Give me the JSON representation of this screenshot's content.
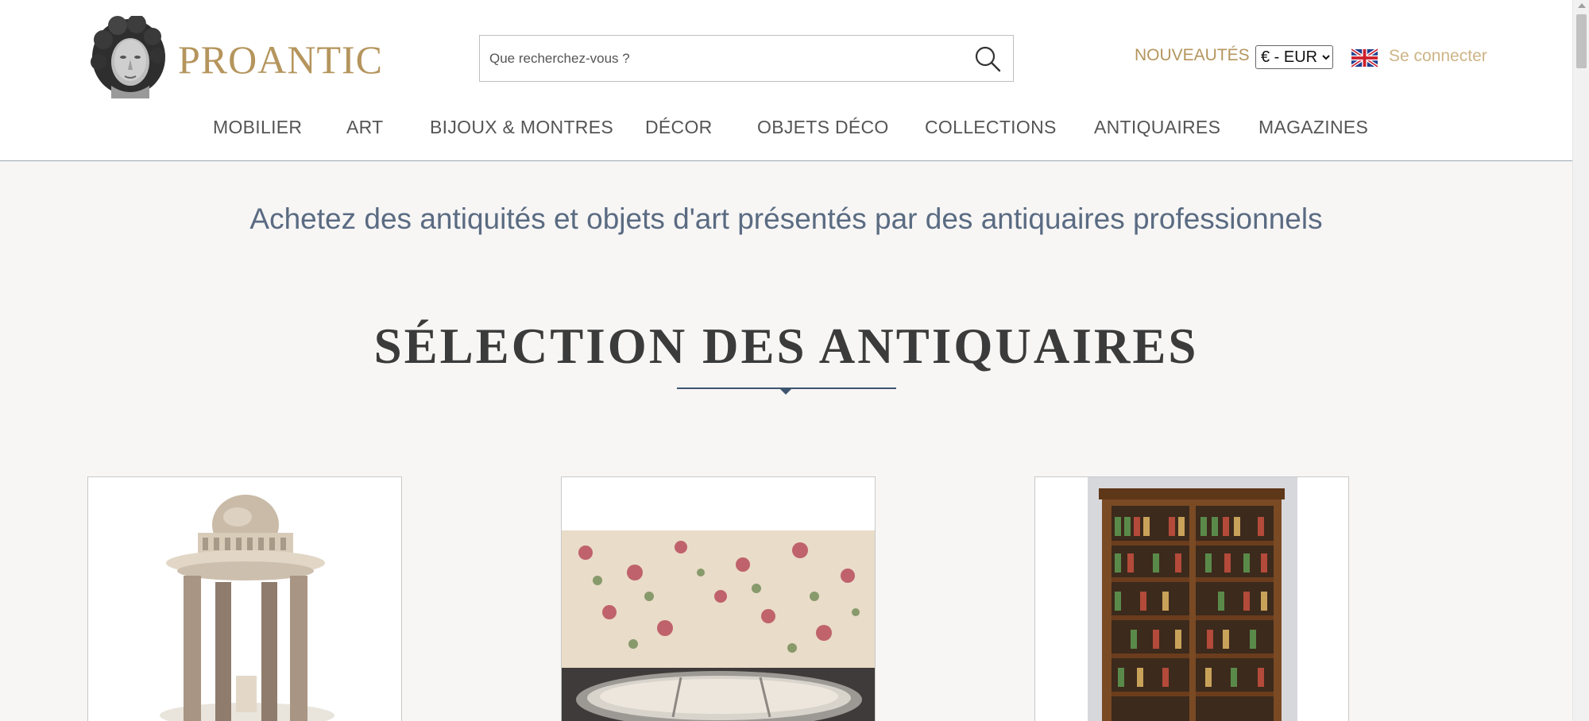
{
  "header": {
    "brand": "PROANTIC",
    "search": {
      "placeholder": "Que recherchez-vous ?"
    },
    "new_label": "NOUVEAUTÉS",
    "currency": {
      "selected": "€ - EUR",
      "options": [
        "€ - EUR"
      ]
    },
    "login_label": "Se connecter",
    "language_icon": "uk-flag-icon"
  },
  "nav": {
    "items": [
      {
        "label": "MOBILIER"
      },
      {
        "label": "ART"
      },
      {
        "label": "BIJOUX & MONTRES"
      },
      {
        "label": "DÉCOR"
      },
      {
        "label": "OBJETS DÉCO"
      },
      {
        "label": "COLLECTIONS"
      },
      {
        "label": "ANTIQUAIRES"
      },
      {
        "label": "MAGAZINES"
      }
    ]
  },
  "main": {
    "tagline": "Achetez des antiquités et objets d'art présentés par des antiquaires professionnels",
    "section_title": "SÉLECTION DES ANTIQUAIRES"
  },
  "colors": {
    "gold": "#b5955d",
    "tagline": "#5a6b82",
    "divider": "#3e5570",
    "background": "#f7f6f5"
  }
}
